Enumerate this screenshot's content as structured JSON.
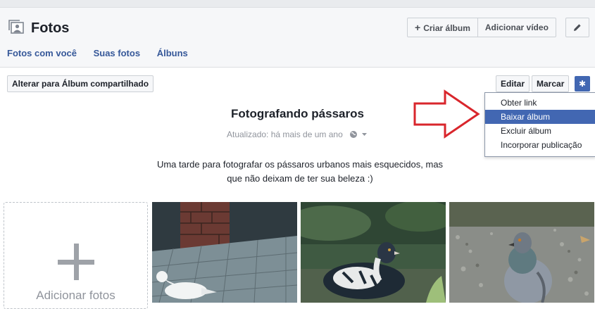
{
  "header": {
    "title": "Fotos",
    "create_album_label": "Criar álbum",
    "add_video_label": "Adicionar vídeo",
    "tabs": [
      "Fotos com você",
      "Suas fotos",
      "Álbuns"
    ]
  },
  "toolbar": {
    "shared_album_label": "Alterar para Álbum compartilhado",
    "edit_label": "Editar",
    "tag_label": "Marcar"
  },
  "menu": {
    "items": [
      "Obter link",
      "Baixar álbum",
      "Excluir álbum",
      "Incorporar publicação"
    ],
    "highlighted": "Baixar álbum"
  },
  "album": {
    "title": "Fotografando pássaros",
    "updated": "Atualizado: há mais de um ano",
    "description": "Uma tarde para fotografar os pássaros urbanos mais esquecidos, mas que não deixam de ter sua beleza :)"
  },
  "add_photos_label": "Adicionar fotos",
  "colors": {
    "accent": "#4267b2",
    "link": "#365899",
    "arrow": "#d9262c"
  }
}
